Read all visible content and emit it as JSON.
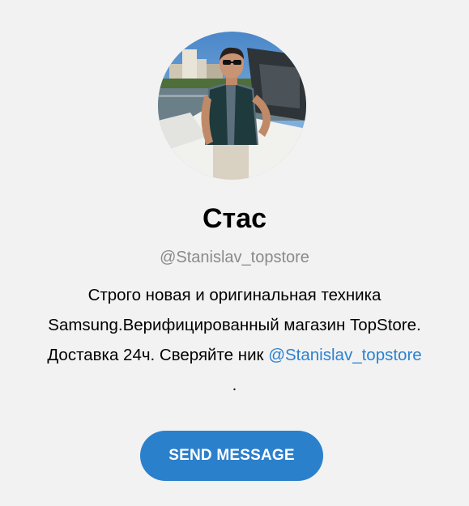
{
  "profile": {
    "name": "Стас",
    "username": "@Stanislav_topstore",
    "bio_line1": "Строго новая и оригинальная техника",
    "bio_line2": "Samsung.Верифицированный магазин TopStore.",
    "bio_line3_text": "Доставка 24ч. Сверяйте ник ",
    "bio_link": "@Stanislav_topstore",
    "bio_end": "."
  },
  "actions": {
    "send_message_label": "SEND MESSAGE"
  },
  "colors": {
    "background": "#f2f2f2",
    "accent": "#2b80cc",
    "link": "#2c82d0",
    "muted_text": "#8a8a8a"
  },
  "icons": {
    "avatar": "profile-photo"
  }
}
